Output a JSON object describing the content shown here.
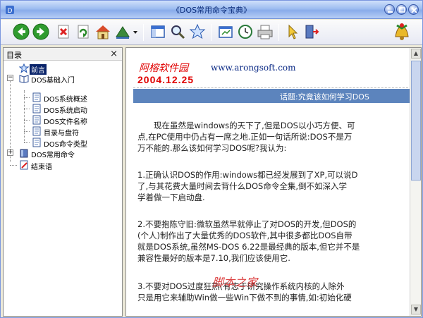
{
  "window": {
    "title": "《DOS常用命令宝典》"
  },
  "toolbar": {
    "icons": [
      "back-icon",
      "forward-icon",
      "stop-icon",
      "refresh-icon",
      "home-icon",
      "tools-icon",
      "dropdown-icon",
      "toggle-panel-icon",
      "search-icon",
      "favorites-icon",
      "options-icon",
      "history-icon",
      "print-icon",
      "pointer-icon",
      "exit-icon",
      "bell-icon"
    ]
  },
  "sidebar": {
    "title": "目录",
    "close": "×",
    "items": [
      {
        "label": "前言",
        "level": 0,
        "selected": true,
        "icon": "star-icon"
      },
      {
        "label": "DOS基础入门",
        "level": 0,
        "expanded": true,
        "icon": "book-icon"
      },
      {
        "label": "DOS系统概述",
        "level": 1,
        "icon": "page-icon"
      },
      {
        "label": "DOS系统启动",
        "level": 1,
        "icon": "page-icon"
      },
      {
        "label": "DOS文件名称",
        "level": 1,
        "icon": "page-icon"
      },
      {
        "label": "目录与盘符",
        "level": 1,
        "icon": "page-icon"
      },
      {
        "label": "DOS命令类型",
        "level": 1,
        "icon": "page-icon"
      },
      {
        "label": "DOS常用命令",
        "level": 0,
        "expanded": false,
        "icon": "book-icon"
      },
      {
        "label": "结束语",
        "level": 0,
        "icon": "page-pencil-icon"
      }
    ]
  },
  "content": {
    "brand": "阿榕软件园",
    "url": "www.arongsoft.com",
    "date": "2004.12.25",
    "topic": "话题:究竟该如何学习DOS",
    "paragraphs": [
      [
        "　　现在虽然是windows的天下了,但是DOS以小巧方便、可",
        "点,在PC使用中仍占有一席之地.正如一句话所说:DOS不是万",
        "万不能的.那么该如何学习DOS呢?我认为:"
      ],
      [
        "1.正确认识DOS的作用:windows都已经发展到了XP,可以说D",
        "了,与其花费大量时间去背什么DOS命令全集,倒不如深入学",
        "学着做一下启动盘."
      ],
      [
        "2.不要抱陈守旧:微软虽然早就停止了对DOS的开发,但DOS的",
        "(个人)制作出了大量优秀的DOS软件,其中很多都比DOS自带",
        "就是DOS系统,虽然MS-DOS 6.22是最经典的版本,但它并不是",
        "兼容性最好的版本是7.10,我们应该使用它."
      ],
      [
        "3.不要对DOS过度狂热(有志于研究操作系统内核的人除外",
        "只是用它来辅助Win做一些Win下做不到的事情,如:初始化硬"
      ]
    ]
  },
  "watermark": {
    "text": "脚本之家"
  }
}
